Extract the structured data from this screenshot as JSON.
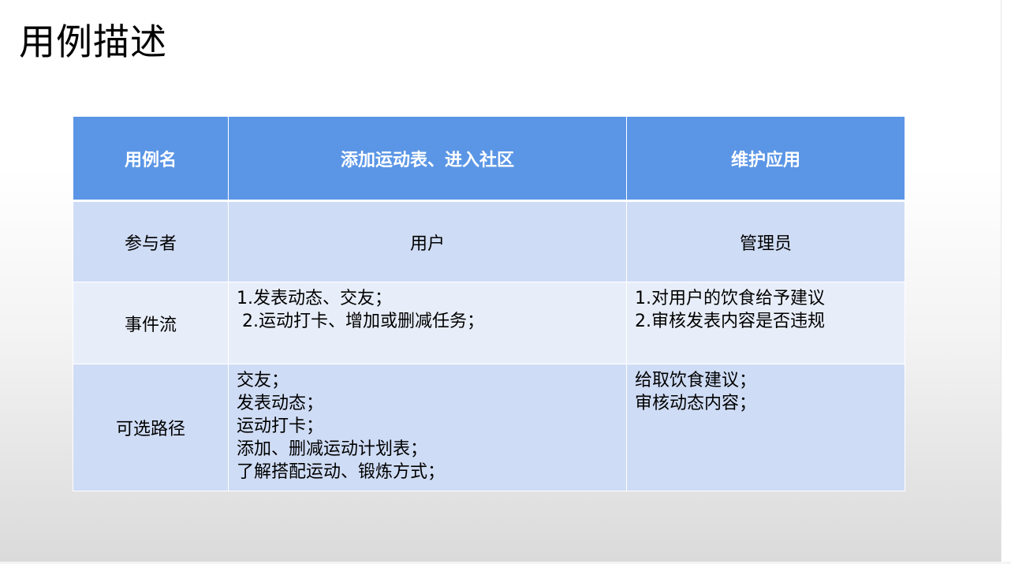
{
  "slide": {
    "title": "用例描述"
  },
  "table": {
    "header": [
      "用例名",
      "添加运动表、进入社区",
      "维护应用"
    ],
    "actor": {
      "label": "参与者",
      "user": "用户",
      "admin": "管理员"
    },
    "flow": {
      "label": "事件流",
      "user": [
        "1.发表动态、交友；",
        " 2.运动打卡、增加或删减任务；"
      ],
      "admin": [
        "1.对用户的饮食给予建议",
        "2.审核发表内容是否违规"
      ]
    },
    "alt": {
      "label": "可选路径",
      "user": [
        "交友；",
        "发表动态；",
        "运动打卡；",
        "添加、删减运动计划表；",
        "了解搭配运动、锻炼方式；"
      ],
      "admin": [
        "给取饮食建议；",
        "审核动态内容；"
      ]
    }
  },
  "colors": {
    "header_bg": "#5b96e6",
    "row_dark": "#cfdcf5",
    "row_light": "#e8eef9"
  }
}
